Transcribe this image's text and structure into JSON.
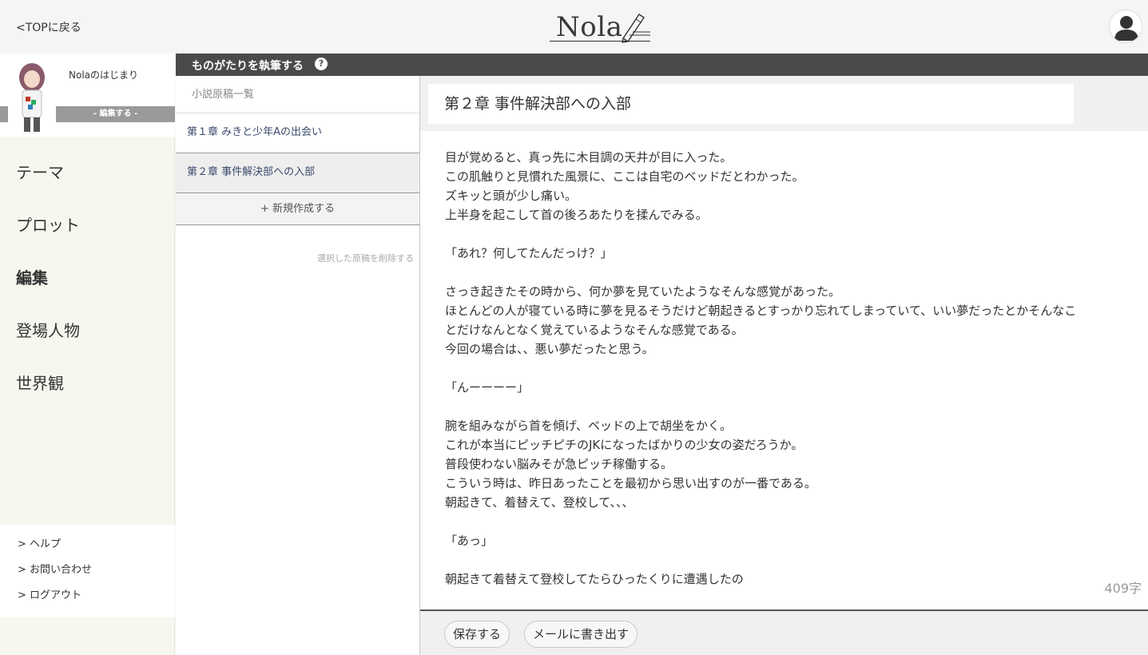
{
  "header": {
    "back_label": "<TOPに戻る",
    "logo_text": "Nola"
  },
  "sidebar": {
    "book_title": "Nolaのはじまり",
    "edit_label": "- 編集する -",
    "nav": [
      {
        "label": "テーマ"
      },
      {
        "label": "プロット"
      },
      {
        "label": "編集"
      },
      {
        "label": "登場人物"
      },
      {
        "label": "世界観"
      }
    ],
    "active_nav": "編集",
    "footer_links": [
      {
        "label": "> ヘルプ"
      },
      {
        "label": "> お問い合わせ"
      },
      {
        "label": "> ログアウト"
      }
    ]
  },
  "section": {
    "title": "ものがたりを執筆する",
    "help_icon": "?"
  },
  "manuscripts": {
    "header": "小説原稿一覧",
    "items": [
      {
        "label": "第１章 みきと少年Aの出会い"
      },
      {
        "label": "第２章 事件解決部への入部"
      }
    ],
    "selected_index": 1,
    "new_label": "+ 新規作成する",
    "delete_label": "選択した原稿を削除する"
  },
  "editor": {
    "chapter_title": "第２章 事件解決部への入部",
    "body": "目が覚めると、真っ先に木目調の天井が目に入った。\nこの肌触りと見慣れた風景に、ここは自宅のベッドだとわかった。\nズキッと頭が少し痛い。\n上半身を起こして首の後ろあたりを揉んでみる。\n\n「あれ？何してたんだっけ？」\n\nさっき起きたその時から、何か夢を見ていたようなそんな感覚があった。\nほとんどの人が寝ている時に夢を見るそうだけど朝起きるとすっかり忘れてしまっていて、いい夢だったとかそんなこ\nとだけなんとなく覚えているようなそんな感覚である。\n今回の場合は、、悪い夢だったと思う。\n\n「んーーーー」\n\n腕を組みながら首を傾げ、ベッドの上で胡坐をかく。\nこれが本当にピッチピチのJKになったばかりの少女の姿だろうか。\n普段使わない脳みそが急ピッチ稼働する。\nこういう時は、昨日あったことを最初から思い出すのが一番である。\n朝起きて、着替えて、登校して、、、\n\n「あっ」\n\n朝起きて着替えて登校してたらひったくりに遭遇したの",
    "char_count": "409字",
    "save_label": "保存する",
    "mail_label": "メールに書き出す"
  }
}
